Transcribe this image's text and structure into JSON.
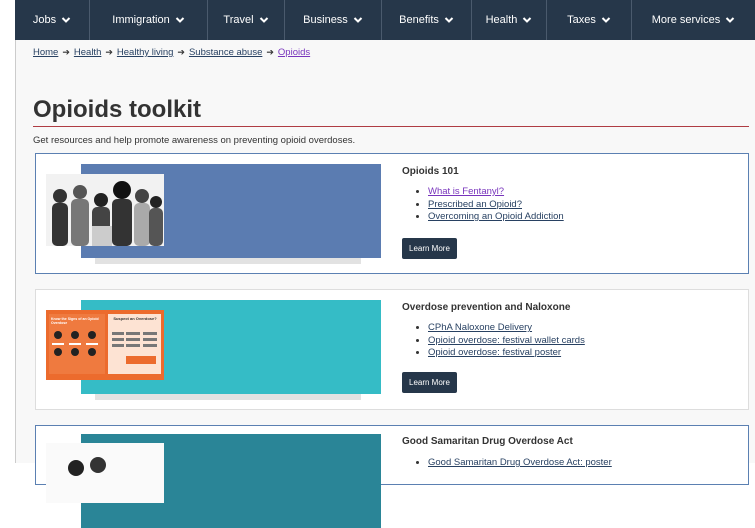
{
  "nav": {
    "items": [
      "Jobs",
      "Immigration",
      "Travel",
      "Business",
      "Benefits",
      "Health",
      "Taxes",
      "More services"
    ]
  },
  "breadcrumb": [
    "Home",
    "Health",
    "Healthy living",
    "Substance abuse",
    "Opioids"
  ],
  "page": {
    "title": "Opioids toolkit",
    "intro": "Get resources and help promote awareness on preventing opioid overdoses."
  },
  "cards": [
    {
      "title": "Opioids 101",
      "links": [
        "What is Fentanyl?",
        "Prescribed an Opioid?",
        "Overcoming an Opioid Addiction"
      ],
      "button": "Learn More",
      "band_color": "#5b7cb1"
    },
    {
      "title": "Overdose prevention and Naloxone",
      "links": [
        "CPhA Naloxone Delivery",
        "Opioid overdose: festival wallet cards",
        "Opioid overdose: festival poster"
      ],
      "button": "Learn More",
      "band_color": "#35bcc6",
      "image": {
        "left_heading": "Know the Signs of an Opioid Overdose",
        "right_heading": "Suspect an Overdose?",
        "accent_color": "#ec6b2d"
      }
    },
    {
      "title": "Good Samaritan Drug Overdose Act",
      "links": [
        "Good Samaritan Drug Overdose Act: poster"
      ],
      "band_color": "#2a8597"
    }
  ],
  "colors": {
    "nav_bg": "#26374a",
    "link": "#284162",
    "visited": "#7834bc",
    "rule": "#af3c43"
  }
}
